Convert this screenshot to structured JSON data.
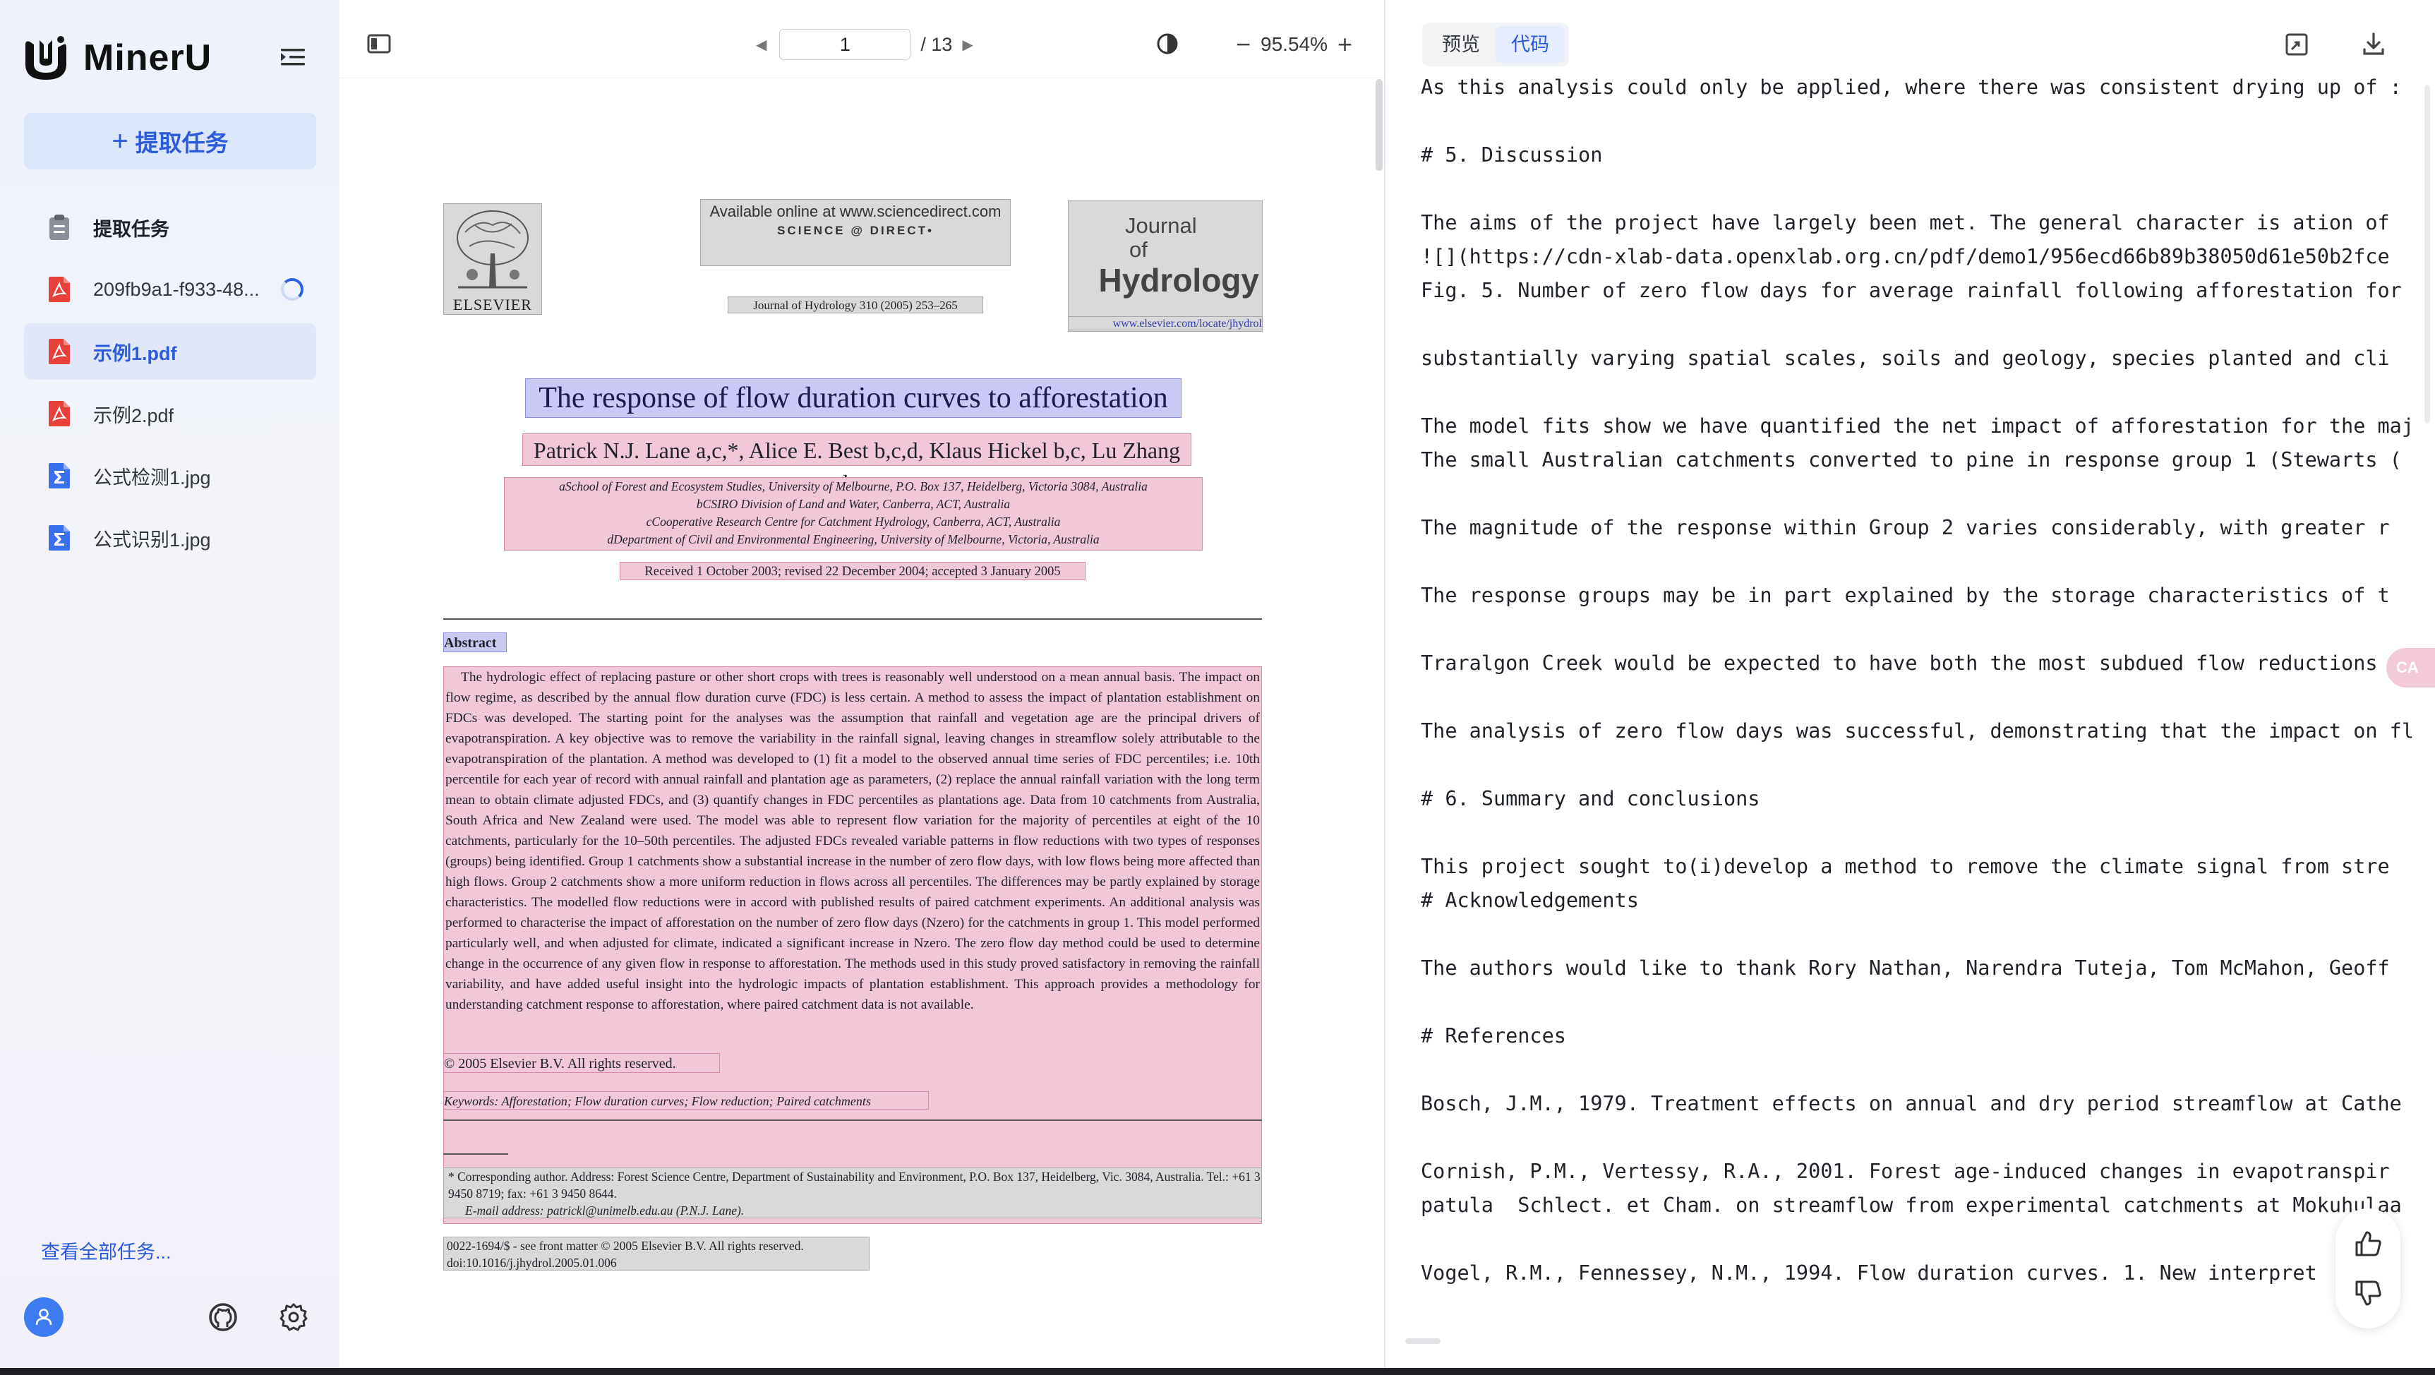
{
  "app": {
    "name": "MinerU"
  },
  "sidebar": {
    "new_task_label": "提取任务",
    "section_label": "提取任务",
    "items": [
      {
        "label": "209fb9a1-f933-48...",
        "type": "pdf",
        "status": "loading"
      },
      {
        "label": "示例1.pdf",
        "type": "pdf",
        "active": true
      },
      {
        "label": "示例2.pdf",
        "type": "pdf"
      },
      {
        "label": "公式检测1.jpg",
        "type": "formula"
      },
      {
        "label": "公式识别1.jpg",
        "type": "formula"
      }
    ],
    "view_all_label": "查看全部任务...",
    "icons": [
      "collapse-icon",
      "avatar-icon",
      "github-icon",
      "settings-icon"
    ]
  },
  "pdf_viewer": {
    "page_input": "1",
    "total_pages": "/ 13",
    "zoom": "95.54%",
    "page": {
      "sd_available": "Available online at www.sciencedirect.com",
      "sd_brand": "SCIENCE @ DIRECT•",
      "journal_line": "Journal of Hydrology 310 (2005) 253–265",
      "journal_name_1": "Journal",
      "journal_name_2": "of",
      "journal_name_3": "Hydrology",
      "journal_url": "www.elsevier.com/locate/jhydrol",
      "elsevier": "ELSEVIER",
      "title": "The response of flow duration curves to afforestation",
      "authors": "Patrick N.J. Lane a,c,*, Alice E. Best b,c,d, Klaus Hickel b,c, Lu Zhang b,c",
      "affiliations": [
        "aSchool of Forest and Ecosystem Studies, University of Melbourne, P.O. Box 137, Heidelberg, Victoria 3084, Australia",
        "bCSIRO Division of Land and Water, Canberra, ACT, Australia",
        "cCooperative Research Centre for Catchment Hydrology, Canberra, ACT, Australia",
        "dDepartment of Civil and Environmental Engineering, University of Melbourne, Victoria, Australia"
      ],
      "received": "Received 1 October 2003; revised 22 December 2004; accepted 3 January 2005",
      "abstract_heading": "Abstract",
      "abstract": "The hydrologic effect of replacing pasture or other short crops with trees is reasonably well understood on a mean annual basis. The impact on flow regime, as described by the annual flow duration curve (FDC) is less certain. A method to assess the impact of plantation establishment on FDCs was developed. The starting point for the analyses was the assumption that rainfall and vegetation age are the principal drivers of evapotranspiration. A key objective was to remove the variability in the rainfall signal, leaving changes in streamflow solely attributable to the evapotranspiration of the plantation. A method was developed to (1) fit a model to the observed annual time series of FDC percentiles; i.e. 10th percentile for each year of record with annual rainfall and plantation age as parameters, (2) replace the annual rainfall variation with the long term mean to obtain climate adjusted FDCs, and (3) quantify changes in FDC percentiles as plantations age. Data from 10 catchments from Australia, South Africa and New Zealand were used. The model was able to represent flow variation for the majority of percentiles at eight of the 10 catchments, particularly for the 10–50th percentiles. The adjusted FDCs revealed variable patterns in flow reductions with two types of responses (groups) being identified. Group 1 catchments show a substantial increase in the number of zero flow days, with low flows being more affected than high flows. Group 2 catchments show a more uniform reduction in flows across all percentiles. The differences may be partly explained by storage characteristics. The modelled flow reductions were in accord with published results of paired catchment experiments. An additional analysis was performed to characterise the impact of afforestation on the number of zero flow days (Nzero) for the catchments in group 1. This model performed particularly well, and when adjusted for climate, indicated a significant increase in Nzero. The zero flow day method could be used to determine change in the occurrence of any given flow in response to afforestation. The methods used in this study proved satisfactory in removing the rainfall variability, and have added useful insight into the hydrologic impacts of plantation establishment. This approach provides a methodology for understanding catchment response to afforestation, where paired catchment data is not available.",
      "copyright": "© 2005 Elsevier B.V. All rights reserved.",
      "keywords": "Keywords: Afforestation; Flow duration curves; Flow reduction; Paired catchments",
      "footnote_1": "* Corresponding author. Address: Forest Science Centre, Department of Sustainability and Environment, P.O. Box 137, Heidelberg, Vic. 3084, Australia. Tel.: +61 3 9450 8719; fax: +61 3 9450 8644.",
      "footnote_2": "E-mail address: patrickl@unimelb.edu.au (P.N.J. Lane).",
      "issn_1": "0022-1694/$ - see front matter © 2005 Elsevier B.V. All rights reserved.",
      "issn_2": "doi:10.1016/j.jhydrol.2005.01.006"
    }
  },
  "right_pane": {
    "tabs": [
      {
        "label": "预览"
      },
      {
        "label": "代码",
        "active": true
      }
    ],
    "lines": [
      "As this analysis could only be applied, where there was consistent drying up of :",
      "# 5. Discussion",
      "The aims of the project have largely been met. The general character is ation of",
      "![](https://cdn-xlab-data.openxlab.org.cn/pdf/demo1/956ecd66b89b38050d61e50b2fce",
      "Fig. 5. Number of zero flow days for average rainfall following afforestation for",
      "substantially varying spatial scales, soils and geology, species planted and cli",
      "The model fits show we have quantified the net impact of afforestation for the maj",
      "The small Australian catchments converted to pine in response group 1 (Stewarts (",
      "The magnitude of the response within Group 2 varies considerably, with greater r",
      "The response groups may be in part explained by the storage characteristics of t",
      "Traralgon Creek would be expected to have both the most subdued flow reductions a",
      "The analysis of zero flow days was successful, demonstrating that the impact on fl",
      "# 6. Summary and conclusions",
      "This project sought to(i)develop a method to remove the climate signal from stre",
      "# Acknowledgements",
      "The authors would like to thank Rory Nathan, Narendra Tuteja, Tom McMahon, Geoff",
      "# References",
      "Bosch, J.M., 1979. Treatment effects on annual and dry period streamflow at Cathe",
      "Cornish, P.M., Vertessy, R.A., 2001. Forest age-induced changes in evapotranspir",
      "patula  Schlect. et Cham. on streamflow from experimental catchments at Mokuhulaa",
      "Vogel, R.M., Fennessey, N.M., 1994. Flow duration curves. 1. New interpret   n :"
    ],
    "side_tag": "CA",
    "icons": [
      "fullscreen-icon",
      "download-icon",
      "thumbs-up-icon",
      "thumbs-down-icon"
    ]
  },
  "colors": {
    "accent": "#2a5bdc",
    "pdf_red": "#e8413a",
    "formula_blue": "#3a6ff0",
    "highlight_pink": "#f0c8d8",
    "highlight_gray": "#d9d9d9",
    "highlight_blue": "#c9c9f3"
  }
}
